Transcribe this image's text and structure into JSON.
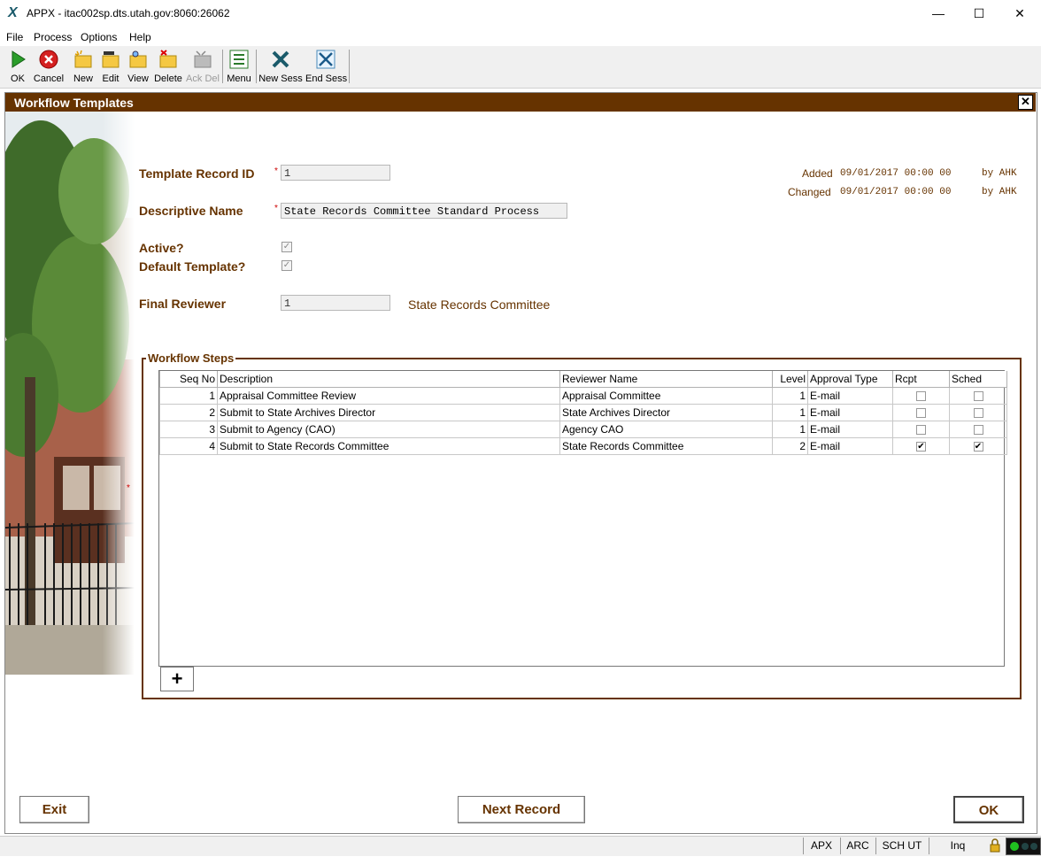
{
  "window": {
    "title": "APPX - itac002sp.dts.utah.gov:8060:26062",
    "minimize": "—",
    "maximize": "☐",
    "close": "✕"
  },
  "menu": [
    "File",
    "Process",
    "Options",
    "Help"
  ],
  "toolbar": [
    {
      "label": "OK",
      "icon": "ok-icon"
    },
    {
      "label": "Cancel",
      "icon": "cancel-icon"
    },
    {
      "label": "New",
      "icon": "new-icon"
    },
    {
      "label": "Edit",
      "icon": "edit-icon"
    },
    {
      "label": "View",
      "icon": "view-icon"
    },
    {
      "label": "Delete",
      "icon": "delete-icon"
    },
    {
      "label": "Ack Del",
      "icon": "ack-del-icon"
    },
    {
      "label": "Menu",
      "icon": "menu-icon"
    },
    {
      "label": "New Sess",
      "icon": "new-session-icon"
    },
    {
      "label": "End Sess",
      "icon": "end-session-icon"
    }
  ],
  "form": {
    "title": "Workflow Templates",
    "template_id_label": "Template Record ID",
    "template_id_value": "1",
    "name_label": "Descriptive Name",
    "name_value": "State Records Committee Standard Process",
    "active_label": "Active?",
    "default_label": "Default Template?",
    "final_reviewer_label": "Final Reviewer",
    "final_reviewer_value": "1",
    "final_reviewer_name": "State Records Committee",
    "added_label": "Added",
    "added_value": "09/01/2017 00:00 00",
    "added_by": "by AHK",
    "changed_label": "Changed",
    "changed_value": "09/01/2017 00:00 00",
    "changed_by": "by AHK",
    "required_marker": "*",
    "active": true,
    "default_template": true
  },
  "steps": {
    "legend": "Workflow Steps",
    "columns": [
      "Seq No",
      "Description",
      "Reviewer Name",
      "Level",
      "Approval Type",
      "Rcpt",
      "Sched"
    ],
    "rows": [
      {
        "seq": "1",
        "desc": "Appraisal Committee Review",
        "reviewer": "Appraisal Committee",
        "level": "1",
        "type": "E-mail",
        "rcpt": false,
        "sched": false
      },
      {
        "seq": "2",
        "desc": "Submit to State Archives Director",
        "reviewer": "State Archives Director",
        "level": "1",
        "type": "E-mail",
        "rcpt": false,
        "sched": false
      },
      {
        "seq": "3",
        "desc": "Submit to Agency (CAO)",
        "reviewer": "Agency CAO",
        "level": "1",
        "type": "E-mail",
        "rcpt": false,
        "sched": false
      },
      {
        "seq": "4",
        "desc": "Submit to State Records Committee",
        "reviewer": "State Records Committee",
        "level": "2",
        "type": "E-mail",
        "rcpt": true,
        "sched": true
      }
    ],
    "add_label": "+"
  },
  "buttons": {
    "exit": "Exit",
    "next": "Next Record",
    "ok": "OK"
  },
  "status": [
    "APX",
    "ARC",
    "SCH UT",
    "Inq"
  ]
}
